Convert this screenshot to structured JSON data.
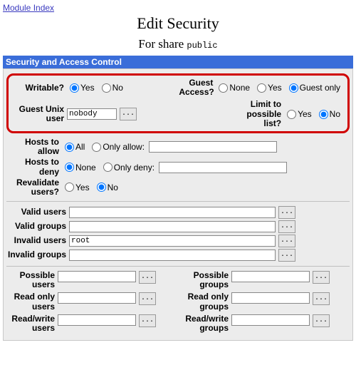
{
  "header": {
    "module_index": "Module Index",
    "title": "Edit Security",
    "for_share_prefix": "For share",
    "share_name": "public"
  },
  "section": {
    "title": "Security and Access Control"
  },
  "labels": {
    "writable": "Writable?",
    "guest_access": "Guest Access?",
    "guest_unix_user": "Guest Unix user",
    "limit_possible_list": "Limit to possible list?",
    "hosts_allow": "Hosts to allow",
    "hosts_deny": "Hosts to deny",
    "revalidate": "Revalidate users?",
    "valid_users": "Valid users",
    "valid_groups": "Valid groups",
    "invalid_users": "Invalid users",
    "invalid_groups": "Invalid groups",
    "possible_users": "Possible users",
    "possible_groups": "Possible groups",
    "read_only_users": "Read only users",
    "read_only_groups": "Read only groups",
    "read_write_users": "Read/write users",
    "read_write_groups": "Read/write groups"
  },
  "options": {
    "yes": "Yes",
    "no": "No",
    "none": "None",
    "guest_only": "Guest only",
    "all": "All",
    "only_allow": "Only allow:",
    "only_deny": "Only deny:"
  },
  "values": {
    "guest_unix_user": "nobody",
    "invalid_users": "root",
    "hosts_allow": "",
    "hosts_deny": "",
    "valid_users": "",
    "valid_groups": "",
    "invalid_groups": "",
    "possible_users": "",
    "possible_groups": "",
    "read_only_users": "",
    "read_only_groups": "",
    "read_write_users": "",
    "read_write_groups": ""
  },
  "buttons": {
    "dots": "..."
  }
}
